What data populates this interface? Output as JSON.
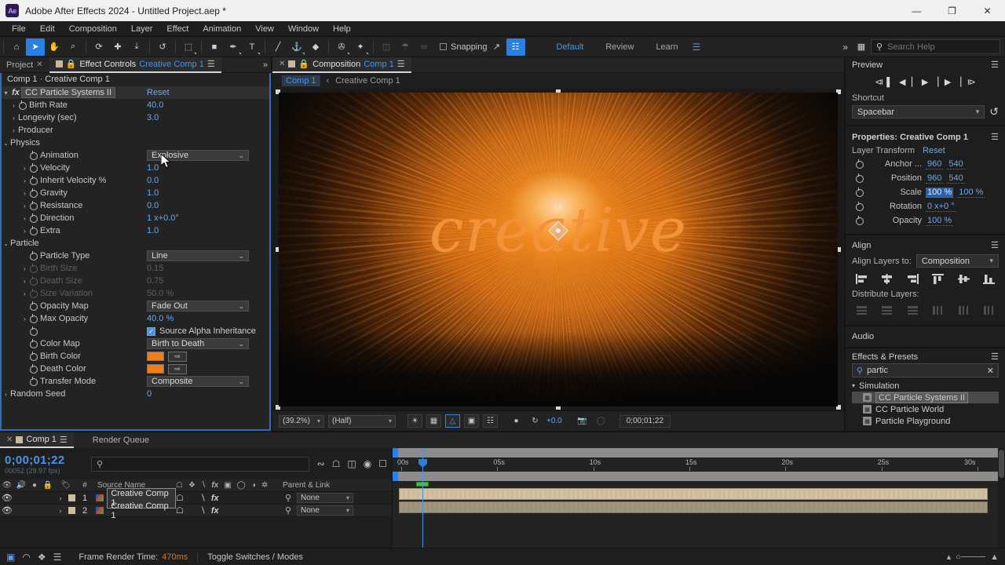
{
  "window": {
    "app_badge": "Ae",
    "title": "Adobe After Effects 2024 - Untitled Project.aep *",
    "minimize": "—",
    "maximize": "❐",
    "close": "✕"
  },
  "menubar": [
    "File",
    "Edit",
    "Composition",
    "Layer",
    "Effect",
    "Animation",
    "View",
    "Window",
    "Help"
  ],
  "toolbar": {
    "tools": [
      {
        "name": "home-icon",
        "glyph": "⌂",
        "selected": false
      },
      {
        "name": "selection-tool",
        "glyph": "➤",
        "selected": true
      },
      {
        "name": "hand-tool",
        "glyph": "✋",
        "selected": false
      },
      {
        "name": "zoom-tool",
        "glyph": "⌕",
        "selected": false
      },
      {
        "name": "orbit-tool",
        "glyph": "⟳",
        "selected": false
      },
      {
        "name": "pan-behind-tool",
        "glyph": "✚",
        "selected": false
      },
      {
        "name": "camera-dolly-tool",
        "glyph": "⤓",
        "selected": false
      },
      {
        "name": "rotation-tool",
        "glyph": "↺",
        "selected": false
      },
      {
        "name": "roto-brush-tool",
        "glyph": "⬚",
        "selected": false
      },
      {
        "name": "shape-tool",
        "glyph": "■",
        "selected": false
      },
      {
        "name": "pen-tool",
        "glyph": "✒",
        "selected": false
      },
      {
        "name": "type-tool",
        "glyph": "T",
        "selected": false
      },
      {
        "name": "brush-tool",
        "glyph": "╱",
        "selected": false
      },
      {
        "name": "clone-stamp-tool",
        "glyph": "⚓",
        "selected": false
      },
      {
        "name": "eraser-tool",
        "glyph": "◆",
        "selected": false
      },
      {
        "name": "puppet-pin-tool",
        "glyph": "✇",
        "selected": false
      },
      {
        "name": "pin-tool",
        "glyph": "✦",
        "selected": false
      }
    ],
    "snapping_label": "Snapping",
    "workspaces": [
      {
        "label": "Default",
        "active": true
      },
      {
        "label": "Review",
        "active": false
      },
      {
        "label": "Learn",
        "active": false
      }
    ],
    "overflow": "»",
    "search_placeholder": "Search Help"
  },
  "effect_controls": {
    "tabs": [
      {
        "label": "Project",
        "active": false,
        "name": "tab-project"
      },
      {
        "label": "Effect Controls",
        "suffix": "Creative Comp 1",
        "active": true,
        "name": "tab-effect-controls"
      }
    ],
    "header": "Comp 1 · Creative Comp 1",
    "effect_name": "CC Particle Systems II",
    "reset_label": "Reset",
    "rows": [
      {
        "label": "Birth Rate",
        "value": "40.0",
        "type": "number",
        "indent": 1,
        "twirl": ">",
        "stopwatch": true
      },
      {
        "label": "Longevity (sec)",
        "value": "3.0",
        "type": "number",
        "indent": 1,
        "twirl": ">",
        "stopwatch": false
      },
      {
        "label": "Producer",
        "value": "",
        "type": "group",
        "indent": 1,
        "twirl": ">",
        "stopwatch": false
      },
      {
        "label": "Physics",
        "value": "",
        "type": "group",
        "indent": 0,
        "twirl": "v",
        "stopwatch": false
      },
      {
        "label": "Animation",
        "value": "Explosive",
        "type": "dropdown",
        "indent": 2,
        "twirl": "",
        "stopwatch": true
      },
      {
        "label": "Velocity",
        "value": "1.0",
        "type": "number",
        "indent": 2,
        "twirl": ">",
        "stopwatch": true
      },
      {
        "label": "Inherit Velocity %",
        "value": "0.0",
        "type": "number",
        "indent": 2,
        "twirl": ">",
        "stopwatch": true
      },
      {
        "label": "Gravity",
        "value": "1.0",
        "type": "number",
        "indent": 2,
        "twirl": ">",
        "stopwatch": true
      },
      {
        "label": "Resistance",
        "value": "0.0",
        "type": "number",
        "indent": 2,
        "twirl": ">",
        "stopwatch": true
      },
      {
        "label": "Direction",
        "value": "1 x+0.0°",
        "type": "number",
        "indent": 2,
        "twirl": ">",
        "stopwatch": true
      },
      {
        "label": "Extra",
        "value": "1.0",
        "type": "number",
        "indent": 2,
        "twirl": ">",
        "stopwatch": true
      },
      {
        "label": "Particle",
        "value": "",
        "type": "group",
        "indent": 0,
        "twirl": "v",
        "stopwatch": false
      },
      {
        "label": "Particle Type",
        "value": "Line",
        "type": "dropdown",
        "indent": 2,
        "twirl": "",
        "stopwatch": true
      },
      {
        "label": "Birth Size",
        "value": "0.15",
        "type": "number",
        "indent": 2,
        "twirl": ">",
        "stopwatch": true,
        "disabled": true
      },
      {
        "label": "Death Size",
        "value": "0.75",
        "type": "number",
        "indent": 2,
        "twirl": ">",
        "stopwatch": true,
        "disabled": true
      },
      {
        "label": "Size Variation",
        "value": "50.0 %",
        "type": "number",
        "indent": 2,
        "twirl": ">",
        "stopwatch": true,
        "disabled": true
      },
      {
        "label": "Opacity Map",
        "value": "Fade Out",
        "type": "dropdown",
        "indent": 2,
        "twirl": "",
        "stopwatch": true
      },
      {
        "label": "Max Opacity",
        "value": "40.0 %",
        "type": "number",
        "indent": 2,
        "twirl": ">",
        "stopwatch": true
      },
      {
        "label": "",
        "value": "Source Alpha Inheritance",
        "type": "checkbox",
        "indent": 2,
        "twirl": "",
        "stopwatch": true,
        "checked": true
      },
      {
        "label": "Color Map",
        "value": "Birth to Death",
        "type": "dropdown",
        "indent": 2,
        "twirl": "",
        "stopwatch": true
      },
      {
        "label": "Birth Color",
        "value": "#F07D18",
        "type": "color",
        "indent": 2,
        "twirl": "",
        "stopwatch": true
      },
      {
        "label": "Death Color",
        "value": "#F07D18",
        "type": "color",
        "indent": 2,
        "twirl": "",
        "stopwatch": true
      },
      {
        "label": "Transfer Mode",
        "value": "Composite",
        "type": "dropdown",
        "indent": 2,
        "twirl": "",
        "stopwatch": true
      },
      {
        "label": "Random Seed",
        "value": "0",
        "type": "number",
        "indent": 0,
        "twirl": ">",
        "stopwatch": false
      }
    ]
  },
  "composition": {
    "tab_label": "Composition",
    "tab_comp": "Comp 1",
    "breadcrumb_active": "Comp 1",
    "breadcrumb_sep": "‹",
    "breadcrumb_child": "Creative Comp 1",
    "canvas_text": "creative",
    "footer": {
      "zoom": "(39.2%)",
      "resolution": "(Half)",
      "exposure": "+0.0",
      "timecode": "0;00;01;22"
    }
  },
  "preview": {
    "title": "Preview",
    "controls": [
      {
        "name": "first-frame-button",
        "glyph": "⧏▐"
      },
      {
        "name": "previous-frame-button",
        "glyph": "◀▕"
      },
      {
        "name": "play-button",
        "glyph": "▶"
      },
      {
        "name": "next-frame-button",
        "glyph": "▏▶"
      },
      {
        "name": "last-frame-button",
        "glyph": "▏⧐"
      }
    ],
    "shortcut_label": "Shortcut",
    "shortcut_value": "Spacebar",
    "reset_icon": "↺"
  },
  "properties": {
    "title": "Properties: Creative Comp 1",
    "section": "Layer Transform",
    "reset_label": "Reset",
    "rows": [
      {
        "name": "Anchor ...",
        "v1": "960",
        "v2": "540",
        "v1_sel": false
      },
      {
        "name": "Position",
        "v1": "960",
        "v2": "540",
        "v1_sel": false
      },
      {
        "name": "Scale",
        "v1": "100 %",
        "v2": "100 %",
        "v1_sel": true
      },
      {
        "name": "Rotation",
        "v1": "0 x+0 °",
        "v2": "",
        "v1_sel": false
      },
      {
        "name": "Opacity",
        "v1": "100 %",
        "v2": "",
        "v1_sel": false
      }
    ]
  },
  "align": {
    "title": "Align",
    "layers_to_label": "Align Layers to:",
    "layers_to_value": "Composition",
    "distribute_label": "Distribute Layers:",
    "align_buttons": [
      "align-left",
      "align-center-h",
      "align-right",
      "align-top",
      "align-center-v",
      "align-bottom"
    ],
    "distribute_buttons": [
      "distribute-top",
      "distribute-center-v",
      "distribute-bottom",
      "distribute-left",
      "distribute-center-h",
      "distribute-right"
    ]
  },
  "audio": {
    "title": "Audio"
  },
  "effects_presets": {
    "title": "Effects & Presets",
    "search_value": "partic",
    "clear_icon": "✕",
    "category": "Simulation",
    "items": [
      {
        "label": "CC Particle Systems II",
        "selected": true
      },
      {
        "label": "CC Particle World",
        "selected": false
      },
      {
        "label": "Particle Playground",
        "selected": false
      }
    ]
  },
  "timeline": {
    "tabs": [
      {
        "label": "Comp 1",
        "active": true
      },
      {
        "label": "Render Queue",
        "active": false
      }
    ],
    "timecode": "0;00;01;22",
    "frames": "00052 (29.97 fps)",
    "search_placeholder": "",
    "columns": [
      "#",
      "Source Name",
      "Parent & Link"
    ],
    "layers": [
      {
        "index": "1",
        "source_name": "Creative Comp 1",
        "parent": "None",
        "selected": true
      },
      {
        "index": "2",
        "source_name": "Creative Comp 1",
        "parent": "None",
        "selected": false
      }
    ],
    "ruler_ticks": [
      "00s",
      "05s",
      "10s",
      "15s",
      "20s",
      "25s",
      "30s"
    ],
    "footer": {
      "render_label": "Frame Render Time:",
      "render_value": "470ms",
      "toggle_label": "Toggle Switches / Modes"
    }
  }
}
